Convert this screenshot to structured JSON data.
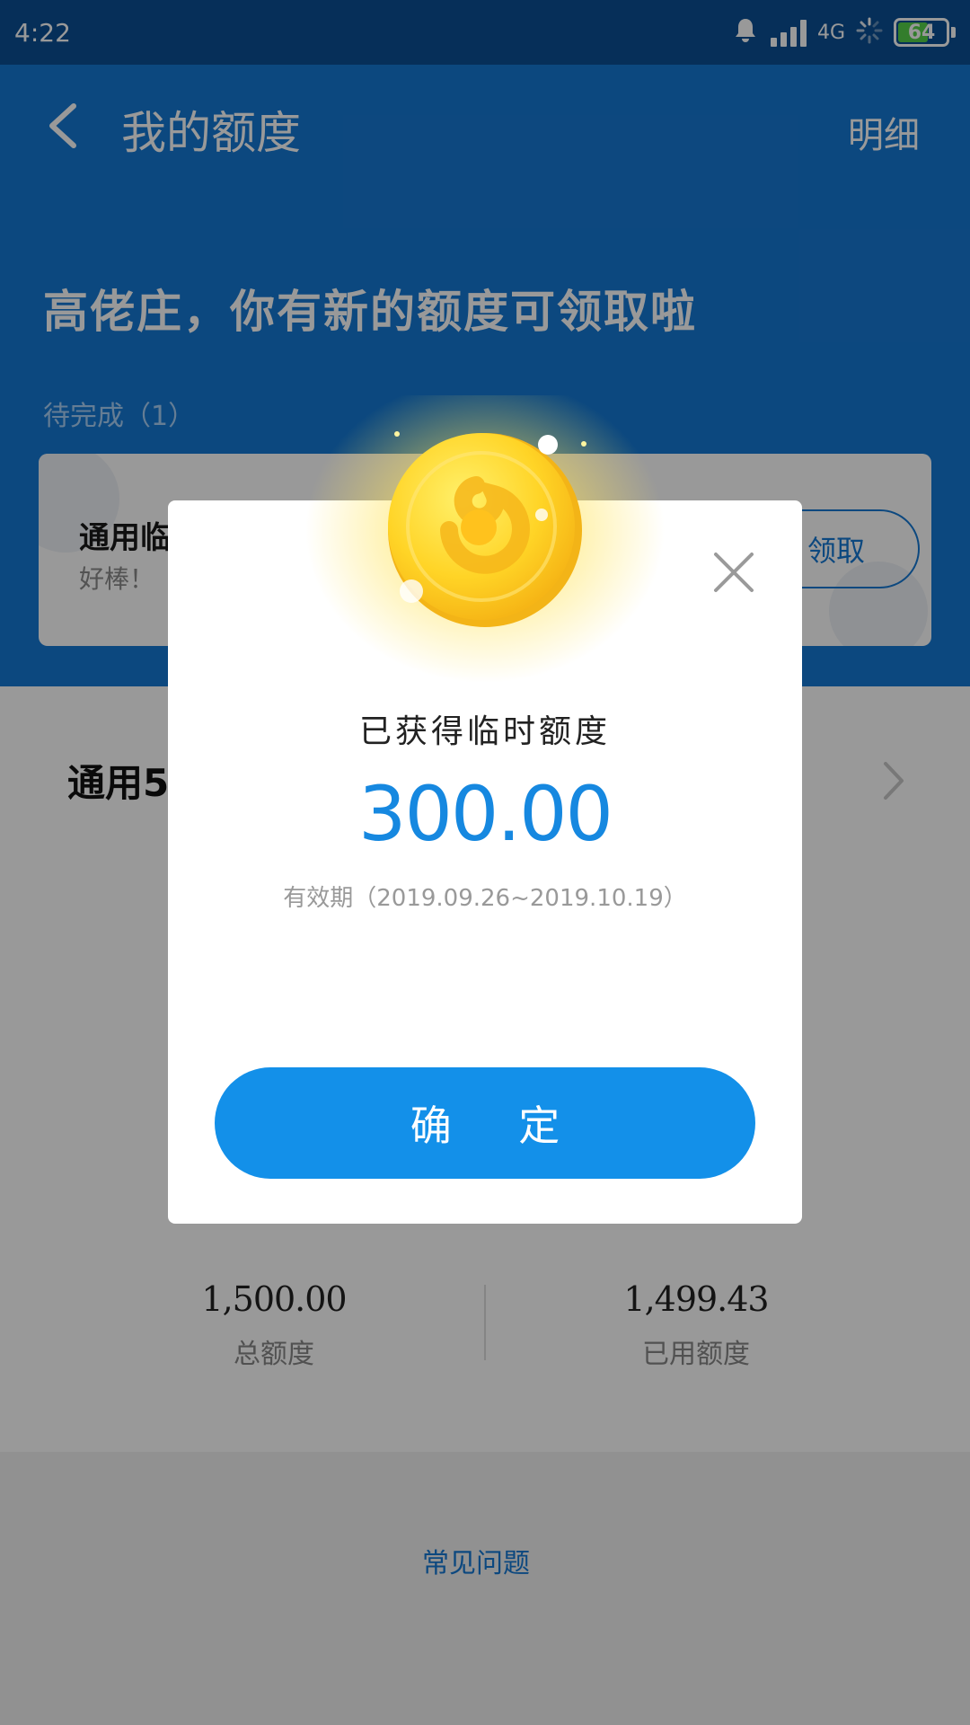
{
  "status_bar": {
    "time": "4:22",
    "network": "4G",
    "battery": "64",
    "battery_level": 0.64
  },
  "header": {
    "title": "我的额度",
    "detail_link": "明细"
  },
  "banner": {
    "headline": "高佬庄，你有新的额度可领取啦",
    "pending_label": "待完成（1）",
    "task": {
      "title": "通用临",
      "subtitle": "好棒！",
      "button": "领取"
    }
  },
  "quota_card": {
    "title": "通用5",
    "total": {
      "value": "1,500.00",
      "label": "总额度"
    },
    "used": {
      "value": "1,499.43",
      "label": "已用额度"
    }
  },
  "faq": {
    "label": "常见问题"
  },
  "dialog": {
    "title": "已获得临时额度",
    "amount": "300.00",
    "validity": "有效期（2019.09.26~2019.10.19）",
    "confirm": "确 定"
  },
  "colors": {
    "primary": "#1578d4",
    "button": "#1390e9",
    "amount": "#1688e0",
    "coin": "#ffd426"
  },
  "icons": [
    "back-arrow-icon",
    "chevron-right-icon",
    "close-icon",
    "coin-icon",
    "bell-icon",
    "signal-icon",
    "loading-icon",
    "battery-icon"
  ]
}
